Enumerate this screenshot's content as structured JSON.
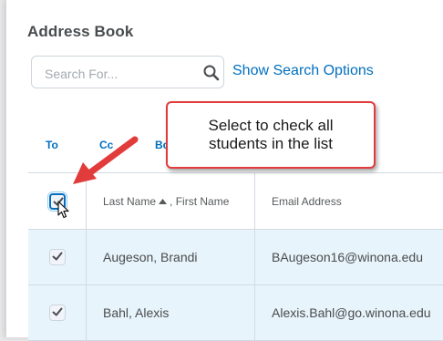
{
  "dialog": {
    "title": "Address Book",
    "search": {
      "placeholder": "Search For...",
      "value": "",
      "options_link": "Show Search Options"
    },
    "tabs": [
      {
        "label": "To"
      },
      {
        "label": "Cc"
      },
      {
        "label": "Bc"
      }
    ],
    "table": {
      "columns": {
        "name_last": "Last Name",
        "name_sep": ", ",
        "name_first": "First Name",
        "email": "Email Address"
      },
      "sort": "ascending",
      "rows": [
        {
          "name": "Augeson, Brandi",
          "email": "BAugeson16@winona.edu",
          "checked": true
        },
        {
          "name": "Bahl, Alexis",
          "email": "Alexis.Bahl@go.winona.edu",
          "checked": true
        }
      ]
    }
  },
  "callout": {
    "line1": "Select to check all",
    "line2": "students in the list",
    "border_color": "#e23b3b"
  },
  "colors": {
    "link": "#006fbf",
    "selected_row": "#e8f4fb",
    "arrow": "#e23b3b"
  }
}
